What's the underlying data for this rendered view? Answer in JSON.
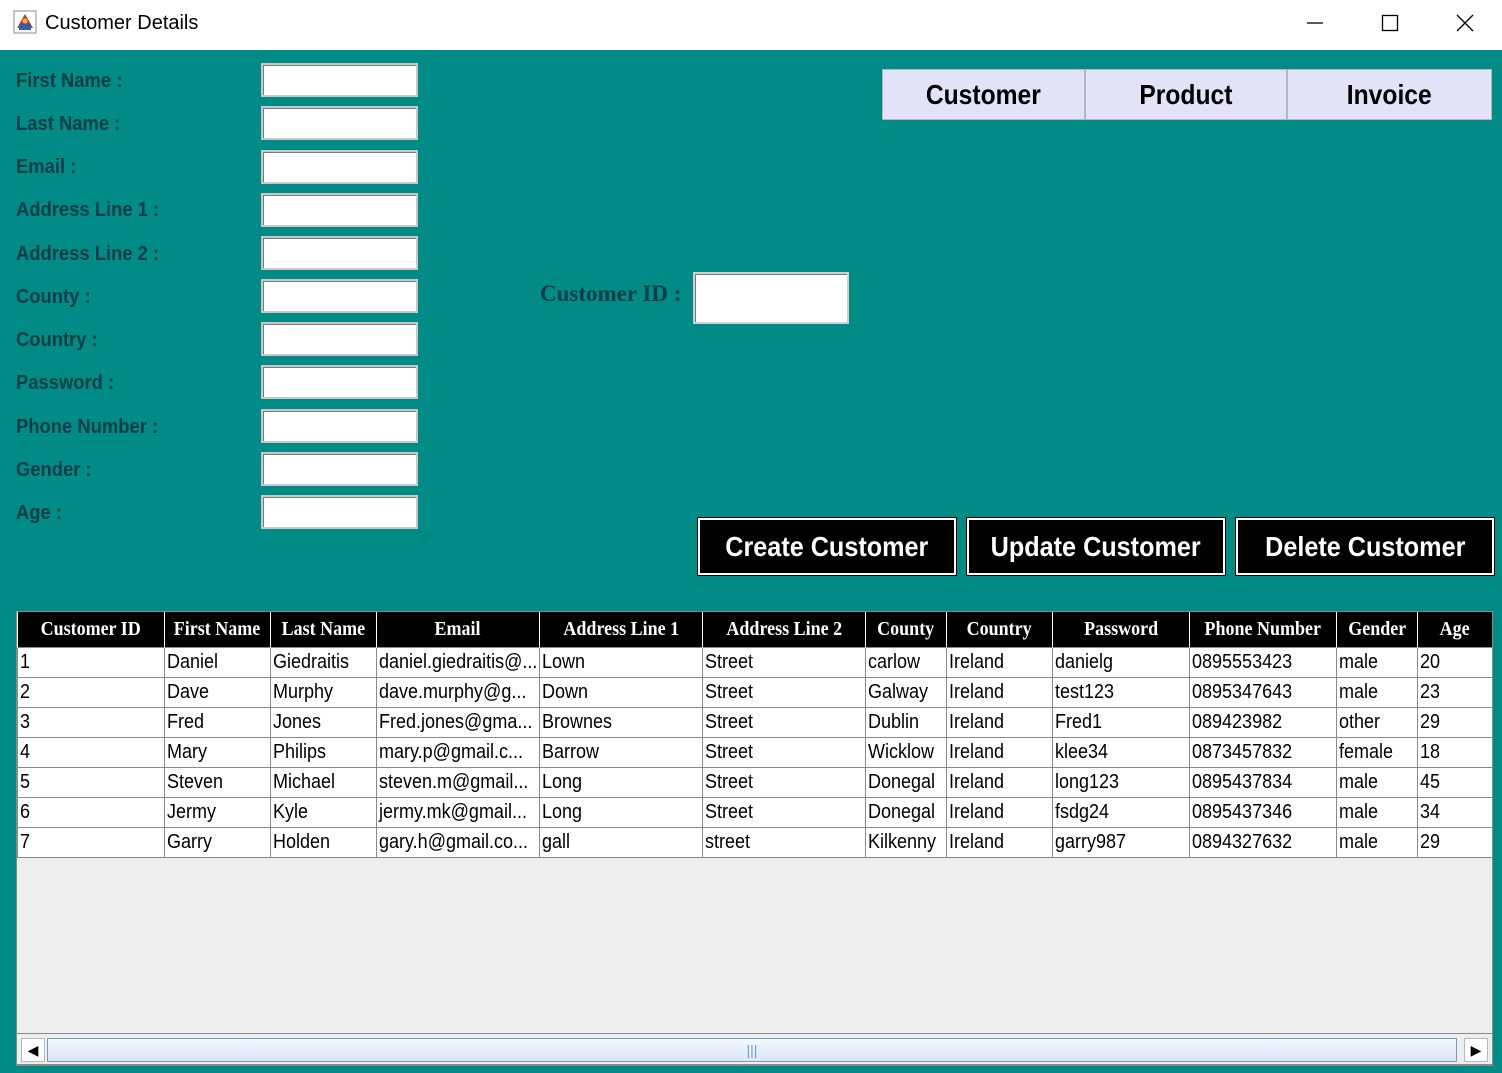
{
  "window": {
    "title": "Customer Details",
    "minimize": "—",
    "maximize": "☐",
    "close": "✕"
  },
  "form": {
    "labels": [
      "First Name :",
      "Last Name :",
      "Email :",
      "Address Line 1 :",
      "Address Line 2 :",
      "County :",
      "Country :",
      "Password :",
      "Phone Number :",
      "Gender :",
      "Age :"
    ],
    "values": [
      "",
      "",
      "",
      "",
      "",
      "",
      "",
      "",
      "",
      "",
      ""
    ]
  },
  "nav": {
    "customer": "Customer",
    "product": "Product",
    "invoice": "Invoice"
  },
  "customer_id": {
    "label": "Customer ID :",
    "value": ""
  },
  "actions": {
    "create": "Create Customer",
    "update": "Update Customer",
    "delete": "Delete Customer"
  },
  "table": {
    "headers": [
      "Customer ID",
      "First Name",
      "Last Name",
      "Email",
      "Address Line 1",
      "Address Line 2",
      "County",
      "Country",
      "Password",
      "Phone Number",
      "Gender",
      "Age"
    ],
    "rows": [
      [
        "1",
        "Daniel",
        "Giedraitis",
        "daniel.giedraitis@...",
        "Lown",
        "Street",
        "carlow",
        "Ireland",
        "danielg",
        "0895553423",
        "male",
        "20"
      ],
      [
        "2",
        "Dave",
        "Murphy",
        "dave.murphy@g...",
        "Down",
        "Street",
        "Galway",
        "Ireland",
        "test123",
        "0895347643",
        "male",
        "23"
      ],
      [
        "3",
        "Fred",
        "Jones",
        "Fred.jones@gma...",
        "Brownes",
        "Street",
        "Dublin",
        "Ireland",
        "Fred1",
        "089423982",
        "other",
        "29"
      ],
      [
        "4",
        "Mary",
        "Philips",
        "mary.p@gmail.c...",
        "Barrow",
        "Street",
        "Wicklow",
        "Ireland",
        "klee34",
        "0873457832",
        "female",
        "18"
      ],
      [
        "5",
        "Steven",
        "Michael",
        "steven.m@gmail...",
        "Long",
        "Street",
        "Donegal",
        "Ireland",
        "long123",
        "0895437834",
        "male",
        "45"
      ],
      [
        "6",
        "Jermy",
        "Kyle",
        "jermy.mk@gmail...",
        "Long",
        "Street",
        "Donegal",
        "Ireland",
        "fsdg24",
        "0895437346",
        "male",
        "34"
      ],
      [
        "7",
        "Garry",
        "Holden",
        "gary.h@gmail.co...",
        "gall",
        "street",
        "Kilkenny",
        "Ireland",
        "garry987",
        "0894327632",
        "male",
        "29"
      ]
    ]
  },
  "scrollbar": {
    "left_arrow": "◀",
    "right_arrow": "▶",
    "grip": "|||"
  },
  "icons": {
    "app": "java-app-icon"
  }
}
